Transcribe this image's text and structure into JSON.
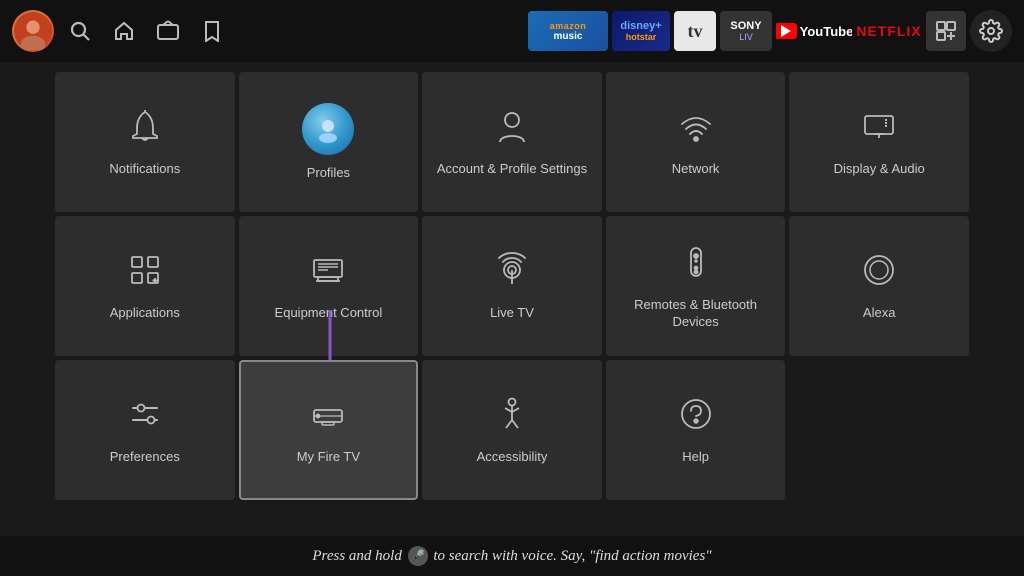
{
  "navbar": {
    "nav_icons": [
      "search",
      "home",
      "tv",
      "bookmark"
    ],
    "apps": [
      {
        "name": "amazon-music",
        "label": "amazon music"
      },
      {
        "name": "disney-hotstar",
        "label": "disney+ hotstar"
      },
      {
        "name": "tv-app",
        "label": "tv"
      },
      {
        "name": "sony-liv",
        "label": "SONY"
      },
      {
        "name": "youtube",
        "label": "YouTube"
      },
      {
        "name": "netflix",
        "label": "NETFLIX"
      },
      {
        "name": "all-apps",
        "label": ""
      }
    ]
  },
  "grid": {
    "items": [
      {
        "id": "notifications",
        "label": "Notifications",
        "icon": "bell"
      },
      {
        "id": "profiles",
        "label": "Profiles",
        "icon": "profile-circle"
      },
      {
        "id": "account-profile-settings",
        "label": "Account & Profile Settings",
        "icon": "person"
      },
      {
        "id": "network",
        "label": "Network",
        "icon": "wifi"
      },
      {
        "id": "display-audio",
        "label": "Display & Audio",
        "icon": "display"
      },
      {
        "id": "applications",
        "label": "Applications",
        "icon": "apps"
      },
      {
        "id": "equipment-control",
        "label": "Equipment Control",
        "icon": "monitor"
      },
      {
        "id": "live-tv",
        "label": "Live TV",
        "icon": "antenna"
      },
      {
        "id": "remotes-bluetooth",
        "label": "Remotes & Bluetooth Devices",
        "icon": "remote"
      },
      {
        "id": "alexa",
        "label": "Alexa",
        "icon": "alexa"
      },
      {
        "id": "preferences",
        "label": "Preferences",
        "icon": "sliders"
      },
      {
        "id": "my-fire-tv",
        "label": "My Fire TV",
        "icon": "fire-tv",
        "highlighted": true
      },
      {
        "id": "accessibility",
        "label": "Accessibility",
        "icon": "accessibility"
      },
      {
        "id": "help",
        "label": "Help",
        "icon": "help"
      }
    ]
  },
  "bottom": {
    "text": "Press and hold",
    "mic_label": "🎤",
    "text2": "to search with voice. Say, \"find action movies\""
  }
}
